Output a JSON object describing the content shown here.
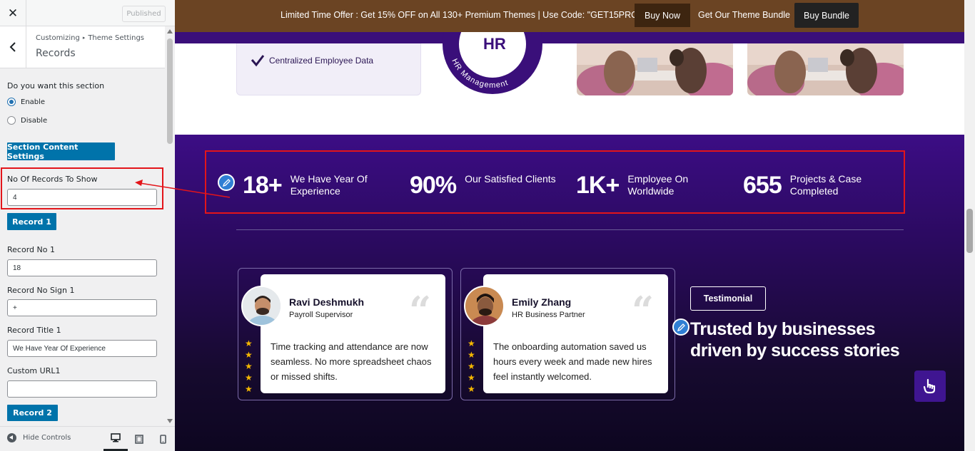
{
  "sidebar": {
    "close_icon": "close-icon",
    "published_label": "Published",
    "breadcrumb": [
      "Customizing",
      "Theme Settings"
    ],
    "panel_title": "Records",
    "section_question": "Do you want this section",
    "radio_options": [
      {
        "label": "Enable",
        "checked": true
      },
      {
        "label": "Disable",
        "checked": false
      }
    ],
    "section_content_btn": "Section Content Settings",
    "no_of_records_label": "No Of Records To Show",
    "no_of_records_value": "4",
    "record1_btn": "Record 1",
    "record_no_label": "Record No 1",
    "record_no_value": "18",
    "record_sign_label": "Record No Sign 1",
    "record_sign_value": "+",
    "record_title_label": "Record Title 1",
    "record_title_value": "We Have Year Of Experience",
    "custom_url_label": "Custom URL1",
    "custom_url_value": "",
    "record2_btn": "Record 2",
    "hide_controls_label": "Hide Controls",
    "devices": [
      "desktop-icon",
      "tablet-icon",
      "mobile-icon"
    ]
  },
  "preview": {
    "promo_text": "Limited Time Offer : Get 15% OFF on All 130+ Premium Themes | Use Code: \"GET15PRO\"",
    "buy_now": "Buy Now",
    "bundle_text": "Get Our Theme Bundle",
    "buy_bundle": "Buy Bundle",
    "top_card_text": "Centralized Employee Data",
    "badge_text": "HR Management",
    "badge_letters": "HR",
    "records": [
      {
        "number": "18+",
        "title": "We Have Year Of Experience"
      },
      {
        "number": "90%",
        "title": "Our Satisfied Clients"
      },
      {
        "number": "1K+",
        "title": "Employee On Worldwide"
      },
      {
        "number": "655",
        "title": "Projects & Case Completed"
      }
    ],
    "testimonials": [
      {
        "name": "Ravi Deshmukh",
        "role": "Payroll Supervisor",
        "text": "Time tracking and attendance are now seamless. No more spreadsheet chaos or missed shifts.",
        "stars": 5
      },
      {
        "name": "Emily Zhang",
        "role": "HR Business Partner",
        "text": "The onboarding automation saved us hours every week and made new hires feel instantly welcomed.",
        "stars": 5
      }
    ],
    "testimonial_btn": "Testimonial",
    "testimonial_title": "Trusted by businesses driven by success stories",
    "colors": {
      "promo_bg": "#6b4423",
      "accent_purple": "#3c0d85",
      "customizer_blue": "#0073aa",
      "highlight_red": "#e3151a",
      "star": "#f5b700"
    }
  }
}
